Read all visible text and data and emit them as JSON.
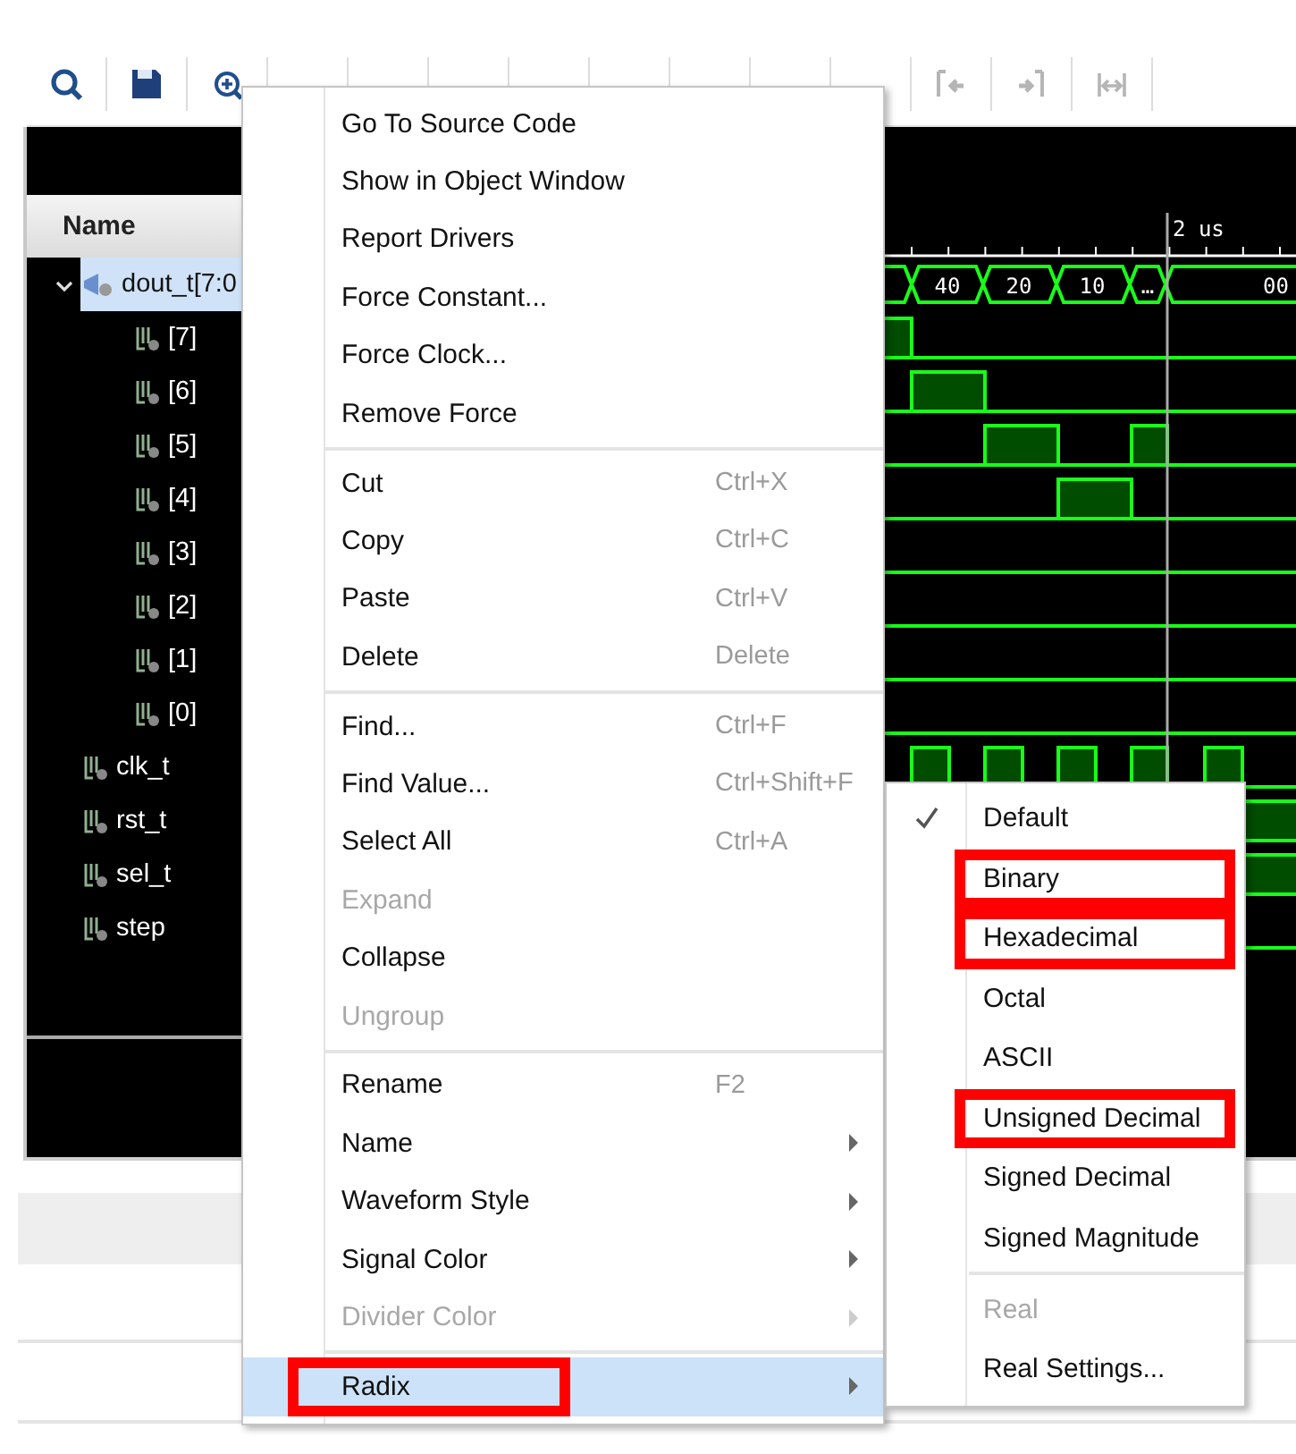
{
  "wave_window": {
    "name_header": "Name",
    "signals": [
      {
        "name": "dout_t[7:0",
        "kind": "bus",
        "selected": true,
        "expanded": true,
        "children": [
          {
            "name": "[7]",
            "kind": "bit",
            "selected": false
          },
          {
            "name": "[6]",
            "kind": "bit",
            "selected": false
          },
          {
            "name": "[5]",
            "kind": "bit",
            "selected": false
          },
          {
            "name": "[4]",
            "kind": "bit",
            "selected": false
          },
          {
            "name": "[3]",
            "kind": "bit",
            "selected": false
          },
          {
            "name": "[2]",
            "kind": "bit",
            "selected": false
          },
          {
            "name": "[1]",
            "kind": "bit",
            "selected": false
          },
          {
            "name": "[0]",
            "kind": "bit",
            "selected": false
          }
        ]
      },
      {
        "name": "clk_t",
        "kind": "bit",
        "selected": false
      },
      {
        "name": "rst_t",
        "kind": "bit",
        "selected": false
      },
      {
        "name": "sel_t",
        "kind": "bit",
        "selected": false
      },
      {
        "name": "step",
        "kind": "bit",
        "selected": false
      }
    ],
    "ruler_label": "2 us",
    "bus_values": [
      "40",
      "20",
      "10",
      "…",
      "00"
    ]
  },
  "context_menu": {
    "items": [
      {
        "kind": "item",
        "label": "Go To Source Code",
        "disabled": false,
        "highlighted": false,
        "submenu": false,
        "marked": false
      },
      {
        "kind": "item",
        "label": "Show in Object Window",
        "disabled": false,
        "highlighted": false,
        "submenu": false,
        "marked": false
      },
      {
        "kind": "item",
        "label": "Report Drivers",
        "disabled": false,
        "highlighted": false,
        "submenu": false,
        "marked": false
      },
      {
        "kind": "item",
        "label": "Force Constant...",
        "disabled": false,
        "highlighted": false,
        "submenu": false,
        "marked": false
      },
      {
        "kind": "item",
        "label": "Force Clock...",
        "disabled": false,
        "highlighted": false,
        "submenu": false,
        "marked": false
      },
      {
        "kind": "item",
        "label": "Remove Force",
        "disabled": false,
        "highlighted": false,
        "submenu": false,
        "marked": false
      },
      {
        "kind": "separator"
      },
      {
        "kind": "item",
        "label": "Cut",
        "shortcut": "Ctrl+X",
        "disabled": false,
        "highlighted": false,
        "submenu": false,
        "marked": false
      },
      {
        "kind": "item",
        "label": "Copy",
        "shortcut": "Ctrl+C",
        "disabled": false,
        "highlighted": false,
        "submenu": false,
        "marked": false
      },
      {
        "kind": "item",
        "label": "Paste",
        "shortcut": "Ctrl+V",
        "disabled": false,
        "highlighted": false,
        "submenu": false,
        "marked": false
      },
      {
        "kind": "item",
        "label": "Delete",
        "shortcut": "Delete",
        "disabled": false,
        "highlighted": false,
        "submenu": false,
        "marked": false
      },
      {
        "kind": "separator"
      },
      {
        "kind": "item",
        "label": "Find...",
        "shortcut": "Ctrl+F",
        "disabled": false,
        "highlighted": false,
        "submenu": false,
        "marked": false
      },
      {
        "kind": "item",
        "label": "Find Value...",
        "shortcut": "Ctrl+Shift+F",
        "disabled": false,
        "highlighted": false,
        "submenu": false,
        "marked": false
      },
      {
        "kind": "item",
        "label": "Select All",
        "shortcut": "Ctrl+A",
        "disabled": false,
        "highlighted": false,
        "submenu": false,
        "marked": false
      },
      {
        "kind": "item",
        "label": "Expand",
        "disabled": true,
        "highlighted": false,
        "submenu": false,
        "marked": false
      },
      {
        "kind": "item",
        "label": "Collapse",
        "disabled": false,
        "highlighted": false,
        "submenu": false,
        "marked": false
      },
      {
        "kind": "item",
        "label": "Ungroup",
        "disabled": true,
        "highlighted": false,
        "submenu": false,
        "marked": false
      },
      {
        "kind": "separator"
      },
      {
        "kind": "item",
        "label": "Rename",
        "shortcut": "F2",
        "disabled": false,
        "highlighted": false,
        "submenu": false,
        "marked": false
      },
      {
        "kind": "item",
        "label": "Name",
        "disabled": false,
        "highlighted": false,
        "submenu": true,
        "marked": false
      },
      {
        "kind": "item",
        "label": "Waveform Style",
        "disabled": false,
        "highlighted": false,
        "submenu": true,
        "marked": false
      },
      {
        "kind": "item",
        "label": "Signal Color",
        "disabled": false,
        "highlighted": false,
        "submenu": true,
        "marked": false
      },
      {
        "kind": "item",
        "label": "Divider Color",
        "disabled": true,
        "highlighted": false,
        "submenu": true,
        "marked": false
      },
      {
        "kind": "separator"
      },
      {
        "kind": "item",
        "label": "Radix",
        "disabled": false,
        "highlighted": true,
        "submenu": true,
        "marked": true
      }
    ]
  },
  "radix_submenu": {
    "items": [
      {
        "kind": "item",
        "label": "Default",
        "checked": true,
        "disabled": false,
        "marked": false
      },
      {
        "kind": "item",
        "label": "Binary",
        "checked": false,
        "disabled": false,
        "marked": true
      },
      {
        "kind": "item",
        "label": "Hexadecimal",
        "checked": false,
        "disabled": false,
        "marked": true
      },
      {
        "kind": "item",
        "label": "Octal",
        "checked": false,
        "disabled": false,
        "marked": false
      },
      {
        "kind": "item",
        "label": "ASCII",
        "checked": false,
        "disabled": false,
        "marked": false
      },
      {
        "kind": "item",
        "label": "Unsigned Decimal",
        "checked": false,
        "disabled": false,
        "marked": true
      },
      {
        "kind": "item",
        "label": "Signed Decimal",
        "checked": false,
        "disabled": false,
        "marked": false
      },
      {
        "kind": "item",
        "label": "Signed Magnitude",
        "checked": false,
        "disabled": false,
        "marked": false
      },
      {
        "kind": "separator"
      },
      {
        "kind": "item",
        "label": "Real",
        "checked": false,
        "disabled": true,
        "marked": false
      },
      {
        "kind": "item",
        "label": "Real Settings...",
        "checked": false,
        "disabled": false,
        "marked": false
      }
    ]
  }
}
